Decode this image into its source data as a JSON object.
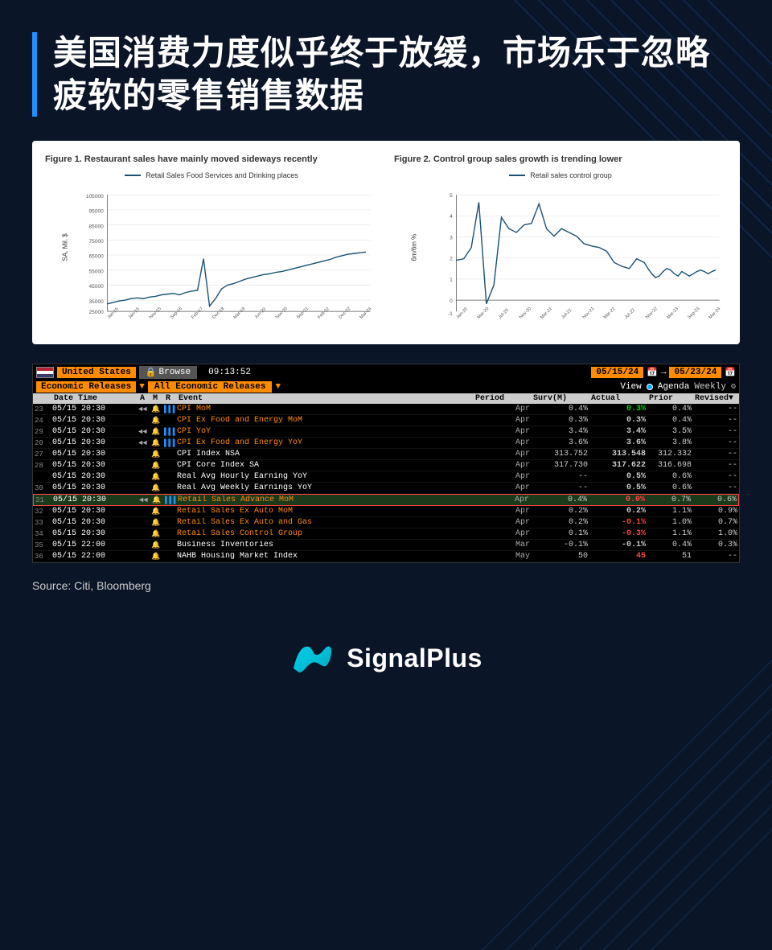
{
  "title": "美国消费力度似乎终于放缓，市场乐于忽略疲软的零售销售数据",
  "background_color": "#0a1628",
  "figure1": {
    "title": "Figure 1. Restaurant sales have mainly moved sideways recently",
    "legend": "Retail Sales Food Services and Drinking places",
    "y_label": "SA, Mil. $",
    "y_ticks": [
      "105000",
      "95000",
      "85000",
      "75000",
      "65000",
      "55000",
      "45000",
      "35000",
      "25000"
    ]
  },
  "figure2": {
    "title": "Figure 2. Control group sales growth is trending lower",
    "legend": "Retail sales control group",
    "y_label": "6m/6m %",
    "y_ticks": [
      "5",
      "4",
      "3",
      "2",
      "1",
      "0",
      "-1"
    ]
  },
  "terminal": {
    "country": "United States",
    "browse_label": "Browse",
    "time": "09:13:52",
    "date_from": "05/15/24",
    "date_to": "05/23/24",
    "eco_releases": "Economic Releases",
    "all_eco": "All Economic Releases",
    "view_label": "View",
    "agenda_label": "Agenda",
    "weekly_label": "Weekly",
    "columns": [
      "",
      "Date Time",
      "A",
      "M",
      "R",
      "Event",
      "Period",
      "Surv(M)",
      "Actual",
      "Prior",
      "Revised"
    ],
    "rows": [
      {
        "num": "23",
        "datetime": "05/15 20:30",
        "a": "◄◄",
        "m": "🔔",
        "r": "▌▌▌",
        "event": "CPI MoM",
        "event_type": "orange",
        "period": "Apr",
        "surv": "0.4%",
        "actual": "0.3%",
        "prior": "0.4%",
        "revised": "--",
        "actual_color": "green"
      },
      {
        "num": "24",
        "datetime": "05/15 20:30",
        "a": "",
        "m": "🔔",
        "r": "",
        "event": "CPI Ex Food and Energy MoM",
        "event_type": "orange",
        "period": "Apr",
        "surv": "0.3%",
        "actual": "0.3%",
        "prior": "0.4%",
        "revised": "--",
        "actual_color": "white"
      },
      {
        "num": "29",
        "datetime": "05/15 20:30",
        "a": "◄◄",
        "m": "🔔",
        "r": "▌▌▌",
        "event": "CPI YoY",
        "event_type": "orange",
        "period": "Apr",
        "surv": "3.4%",
        "actual": "3.4%",
        "prior": "3.5%",
        "revised": "--",
        "actual_color": "white"
      },
      {
        "num": "20",
        "datetime": "05/15 20:30",
        "a": "◄◄",
        "m": "🔔",
        "r": "▌▌▌",
        "event": "CPI Ex Food and Energy YoY",
        "event_type": "orange",
        "period": "Apr",
        "surv": "3.6%",
        "actual": "3.6%",
        "prior": "3.8%",
        "revised": "--",
        "actual_color": "white"
      },
      {
        "num": "27",
        "datetime": "05/15 20:30",
        "a": "",
        "m": "🔔",
        "r": "",
        "event": "CPI Index NSA",
        "event_type": "white",
        "period": "Apr",
        "surv": "313.752",
        "actual": "313.548",
        "prior": "312.332",
        "revised": "--",
        "actual_color": "white"
      },
      {
        "num": "28",
        "datetime": "05/15 20:30",
        "a": "",
        "m": "🔔",
        "r": "",
        "event": "CPI Core Index SA",
        "event_type": "white",
        "period": "Apr",
        "surv": "317.730",
        "actual": "317.622",
        "prior": "316.698",
        "revised": "--",
        "actual_color": "white"
      },
      {
        "num": "",
        "datetime": "05/15 20:30",
        "a": "",
        "m": "🔔",
        "r": "",
        "event": "Real Avg Hourly Earning YoY",
        "event_type": "white",
        "period": "Apr",
        "surv": "--",
        "actual": "0.5%",
        "prior": "0.6%",
        "revised": "--",
        "actual_color": "white"
      },
      {
        "num": "30",
        "datetime": "05/15 20:30",
        "a": "",
        "m": "🔔",
        "r": "",
        "event": "Real Avg Weekly Earnings YoY",
        "event_type": "white",
        "period": "Apr",
        "surv": "--",
        "actual": "0.5%",
        "prior": "0.6%",
        "revised": "--",
        "actual_color": "white"
      },
      {
        "num": "31",
        "datetime": "05/15 20:30",
        "a": "◄◄",
        "m": "🔔",
        "r": "▌▌▌",
        "event": "Retail Sales Advance MoM",
        "event_type": "orange",
        "period": "Apr",
        "surv": "0.4%",
        "actual": "0.0%",
        "prior": "0.7%",
        "revised": "0.6%",
        "actual_color": "red",
        "highlighted": true
      },
      {
        "num": "32",
        "datetime": "05/15 20:30",
        "a": "",
        "m": "🔔",
        "r": "",
        "event": "Retail Sales Ex Auto MoM",
        "event_type": "orange",
        "period": "Apr",
        "surv": "0.2%",
        "actual": "0.2%",
        "prior": "1.1%",
        "revised": "0.9%",
        "actual_color": "white"
      },
      {
        "num": "33",
        "datetime": "05/15 20:30",
        "a": "",
        "m": "🔔",
        "r": "",
        "event": "Retail Sales Ex Auto and Gas",
        "event_type": "orange",
        "period": "Apr",
        "surv": "0.2%",
        "actual": "-0.1%",
        "prior": "1.0%",
        "revised": "0.7%",
        "actual_color": "red"
      },
      {
        "num": "34",
        "datetime": "05/15 20:30",
        "a": "",
        "m": "🔔",
        "r": "",
        "event": "Retail Sales Control Group",
        "event_type": "orange",
        "period": "Apr",
        "surv": "0.1%",
        "actual": "-0.3%",
        "prior": "1.1%",
        "revised": "1.0%",
        "actual_color": "red"
      },
      {
        "num": "35",
        "datetime": "05/15 22:00",
        "a": "",
        "m": "🔔",
        "r": "",
        "event": "Business Inventories",
        "event_type": "white",
        "period": "Mar",
        "surv": "-0.1%",
        "actual": "-0.1%",
        "prior": "0.4%",
        "revised": "0.3%",
        "actual_color": "white"
      },
      {
        "num": "36",
        "datetime": "05/15 22:00",
        "a": "",
        "m": "🔔",
        "r": "",
        "event": "NAHB Housing Market Index",
        "event_type": "white",
        "period": "May",
        "surv": "50",
        "actual": "45",
        "prior": "51",
        "revised": "--",
        "actual_color": "red"
      }
    ]
  },
  "source": "Source: Citi, Bloomberg",
  "brand": {
    "name": "SignalPlus"
  }
}
